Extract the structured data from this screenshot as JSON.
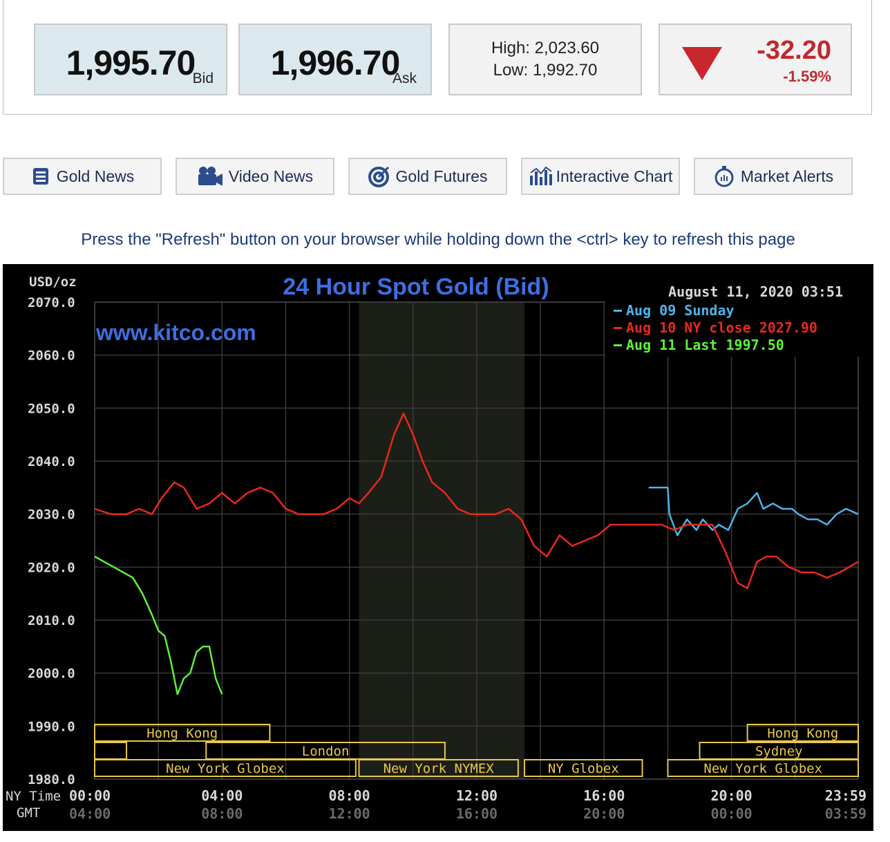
{
  "quote": {
    "bid": "1,995.70",
    "bid_label": "Bid",
    "ask": "1,996.70",
    "ask_label": "Ask",
    "high": "High: 2,023.60",
    "low": "Low: 1,992.70",
    "change": "-32.20",
    "change_pct": "-1.59%"
  },
  "nav": [
    {
      "label": "Gold News",
      "icon": "news-icon"
    },
    {
      "label": "Video News",
      "icon": "video-camera-icon"
    },
    {
      "label": "Gold Futures",
      "icon": "target-icon"
    },
    {
      "label": "Interactive Chart",
      "icon": "bar-chart-icon"
    },
    {
      "label": "Market Alerts",
      "icon": "alarm-clock-icon"
    }
  ],
  "notice": "Press the \"Refresh\" button on your browser while holding down the <ctrl> key to refresh this page",
  "colors": {
    "accent_down": "#c0282d",
    "aug09": "#4fb3e8",
    "aug10": "#e8281e",
    "aug11": "#5ef03a",
    "title": "#3d6fe0",
    "session": "#e8c84a"
  },
  "chart_data": {
    "type": "line",
    "title": "24 Hour Spot Gold (Bid)",
    "watermark": "www.kitco.com",
    "ylabel": "USD/oz",
    "timestamp": "August 11, 2020 03:51",
    "ylim": [
      1980,
      2070
    ],
    "yticks": [
      "2070.0",
      "2060.0",
      "2050.0",
      "2040.0",
      "2030.0",
      "2020.0",
      "2010.0",
      "2000.0",
      "1990.0",
      "1980.0"
    ],
    "x_row_label": "NY Time",
    "x_row2_label": "GMT",
    "xticks_ny": [
      "00:00",
      "04:00",
      "08:00",
      "12:00",
      "16:00",
      "20:00",
      "23:59"
    ],
    "xticks_gmt": [
      "04:00",
      "08:00",
      "12:00",
      "16:00",
      "20:00",
      "00:00",
      "03:59"
    ],
    "xticks_hours": [
      0,
      4,
      8,
      12,
      16,
      20,
      23.98
    ],
    "xlim": [
      0,
      23.98
    ],
    "legend": [
      "Aug 09 Sunday",
      "Aug 10 NY close 2027.90",
      "Aug 11 Last 1997.50"
    ],
    "shaded_hours": [
      8.3,
      13.5
    ],
    "sessions": [
      {
        "name": "Hong Kong",
        "start": 0,
        "end": 5.5,
        "row": 1
      },
      {
        "name": "",
        "start": 0,
        "end": 1,
        "row": 2
      },
      {
        "name": "London",
        "start": 3.5,
        "end": 11,
        "row": 2
      },
      {
        "name": "New York Globex",
        "start": 0,
        "end": 8.2,
        "row": 3
      },
      {
        "name": "New York NYMEX",
        "start": 8.3,
        "end": 13.3,
        "row": 3
      },
      {
        "name": "NY Globex",
        "start": 13.5,
        "end": 17.2,
        "row": 3
      },
      {
        "name": "Hong Kong",
        "start": 20.5,
        "end": 23.98,
        "row": 1
      },
      {
        "name": "Sydney",
        "start": 19,
        "end": 23.98,
        "row": 2
      },
      {
        "name": "New York Globex",
        "start": 18,
        "end": 23.98,
        "row": 3
      }
    ],
    "series": [
      {
        "name": "Aug 09 Sunday",
        "x": [
          17.4,
          18.0,
          18.05,
          18.3,
          18.6,
          18.9,
          19.1,
          19.4,
          19.6,
          19.9,
          20.2,
          20.5,
          20.8,
          21.0,
          21.3,
          21.6,
          21.9,
          22.1,
          22.4,
          22.7,
          23.0,
          23.3,
          23.6,
          23.98
        ],
        "values": [
          2035,
          2035,
          2030,
          2026,
          2029,
          2027,
          2029,
          2027,
          2028,
          2027,
          2031,
          2032,
          2034,
          2031,
          2032,
          2031,
          2031,
          2030,
          2029,
          2029,
          2028,
          2030,
          2031,
          2030
        ]
      },
      {
        "name": "Aug 10 NY close 2027.90",
        "x": [
          0,
          0.5,
          1,
          1.4,
          1.8,
          2.1,
          2.5,
          2.8,
          3.2,
          3.6,
          4.0,
          4.4,
          4.8,
          5.2,
          5.6,
          6.0,
          6.4,
          6.8,
          7.2,
          7.6,
          8.0,
          8.3,
          8.6,
          9.0,
          9.4,
          9.7,
          10.0,
          10.3,
          10.6,
          11.0,
          11.4,
          11.8,
          12.2,
          12.6,
          13.0,
          13.4,
          13.8,
          14.2,
          14.6,
          15.0,
          15.4,
          15.8,
          16.2,
          16.6,
          17.0,
          17.4,
          17.8,
          18.2,
          18.6,
          19.0,
          19.4,
          19.8,
          20.2,
          20.5,
          20.8,
          21.1,
          21.4,
          21.8,
          22.2,
          22.6,
          23.0,
          23.4,
          23.98
        ],
        "values": [
          2031,
          2030,
          2030,
          2031,
          2030,
          2033,
          2036,
          2035,
          2031,
          2032,
          2034,
          2032,
          2034,
          2035,
          2034,
          2031,
          2030,
          2030,
          2030,
          2031,
          2033,
          2032,
          2034,
          2037,
          2045,
          2049,
          2045,
          2040,
          2036,
          2034,
          2031,
          2030,
          2030,
          2030,
          2031,
          2029,
          2024,
          2022,
          2026,
          2024,
          2025,
          2026,
          2028,
          2028,
          2028,
          2028,
          2028,
          2027,
          2028,
          2028,
          2028,
          2023,
          2017,
          2016,
          2021,
          2022,
          2022,
          2020,
          2019,
          2019,
          2018,
          2019,
          2021
        ]
      },
      {
        "name": "Aug 11 Last 1997.50",
        "x": [
          0,
          0.3,
          0.6,
          0.9,
          1.2,
          1.5,
          1.8,
          2.0,
          2.2,
          2.4,
          2.6,
          2.8,
          3.0,
          3.2,
          3.4,
          3.6,
          3.8,
          4.0
        ],
        "values": [
          2022,
          2021,
          2020,
          2019,
          2018,
          2015,
          2011,
          2008,
          2007,
          2002,
          1996,
          1999,
          2000,
          2004,
          2005,
          2005,
          1999,
          1996
        ]
      }
    ]
  }
}
